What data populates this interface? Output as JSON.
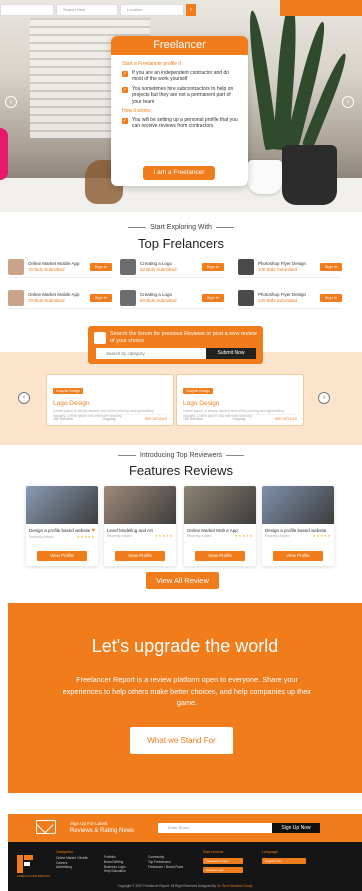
{
  "topbar": {
    "search_placeholder": "Search Here",
    "location_placeholder": "Location",
    "go_label": "›"
  },
  "hero": {
    "card_title": "Freelancer",
    "question": "Start a Freelancer profile if :",
    "checks": [
      "If you are an independent contractor and do most of the work yourself",
      "You sometimes hire subcontractors to help on projects but they are not a permanent part of your team",
      "You will be setting up a personal profile that you can receive reviews from contractors"
    ],
    "how_it_works": "How it works:",
    "cta_label": "I am a Freelancer",
    "prev_icon": "‹",
    "next_icon": "›"
  },
  "explore": {
    "eyebrow": "Start Exploring With",
    "title": "Top Frelancers",
    "freelancers": [
      {
        "title": "Online Market Mobile App",
        "sub": "70 Bids Submitted",
        "btn": "Sign In",
        "color": "#c9a38a"
      },
      {
        "title": "Creating a Logo",
        "sub": "60 Bids Submitted",
        "btn": "Sign In",
        "color": "#6d6d6d"
      },
      {
        "title": "Photoshop Flyer Design",
        "sub": "100 Bids Submitted",
        "btn": "Sign In",
        "color": "#4a4a4a"
      },
      {
        "title": "Online Market Mobile App",
        "sub": "70 Bids Submitted",
        "btn": "Sign In",
        "color": "#c9a38a"
      },
      {
        "title": "Creating a Logo",
        "sub": "60 Bids Submitted",
        "btn": "Sign In",
        "color": "#6d6d6d"
      },
      {
        "title": "Photoshop Flyer Design",
        "sub": "100 Bids Submitted",
        "btn": "Sign In",
        "color": "#4a4a4a"
      }
    ]
  },
  "forum": {
    "text": "Search the forum for previous Reviews or post a new review of your choice",
    "placeholder": "Search by category",
    "submit": "Submit Now"
  },
  "reviews": {
    "cards": [
      {
        "tag": "Graphic Design",
        "name": "Logo Design",
        "desc": "Lorem ipsum is simply dummy text of the printing and typesetting industry. Lorem ipsum has been the industry.",
        "left": "180 Reviews",
        "mid": "Ongoing",
        "right": "SEE DETAILS"
      },
      {
        "tag": "Graphic Design",
        "name": "Logo Design",
        "desc": "Lorem ipsum is simply dummy text of the printing and typesetting industry. Lorem ipsum has been the industry.",
        "left": "180 Reviews",
        "mid": "Ongoing",
        "right": "SEE DETAILS"
      }
    ],
    "prev_icon": "‹",
    "next_icon": "›"
  },
  "reviewers": {
    "eyebrow": "Introducing Top Reviewers",
    "title": "Features Reviews",
    "items": [
      {
        "title": "Design a profile based website",
        "author": "Recently Added",
        "stars": "★★★★★",
        "btn": "View Profile",
        "heart": "♥",
        "color": "#8a9bb5"
      },
      {
        "title": "Level Modeling and Art",
        "author": "Recently Added",
        "stars": "★★★★★",
        "btn": "View Profile",
        "heart": "",
        "color": "#a08a78"
      },
      {
        "title": "Online Market Mob e App",
        "author": "Recently Added",
        "stars": "★★★★★",
        "btn": "View Profile",
        "heart": "",
        "color": "#8e8473"
      },
      {
        "title": "Design a profile based website",
        "author": "Recently Added",
        "stars": "★★★★★",
        "btn": "View Profile",
        "heart": "",
        "color": "#7f91ad"
      }
    ],
    "view_all": "View All Review"
  },
  "upgrade": {
    "title": "Let's upgrade the world",
    "body": "Freelancer Report is a review platform open to everyone. Share your experiences to help others make better choices, and help companies up their game.",
    "button": "What we Stand For"
  },
  "footer": {
    "news_line1": "Sign Up For Latest",
    "news_line2": "Reviews & Rating News",
    "news_placeholder": "Enter Email",
    "news_button": "Sign Up Now",
    "brand": "FREELANCER REPORT",
    "cols": [
      {
        "h": "Categories",
        "items": [
          "Online Market / Mobile",
          "Careers",
          "Advertising"
        ]
      },
      {
        "h": "",
        "items": [
          "Portfolio",
          "Brand Writing",
          "Business Login",
          "Help Education"
        ]
      },
      {
        "h": "",
        "items": [
          "Community",
          "Top Freelancers",
          "Freelancer / Brand Plans"
        ]
      },
      {
        "h": "Start reviews",
        "items": []
      },
      {
        "h": "Language",
        "items": []
      }
    ],
    "pill1": "Freelancer Login",
    "pill2": "Review Login",
    "pill3": "English (UK)",
    "copyright": "Copyright © 2007 Freelancer Report. All Right Reserved Designed By",
    "copyright_by": "Go Tech Solutions Group"
  }
}
